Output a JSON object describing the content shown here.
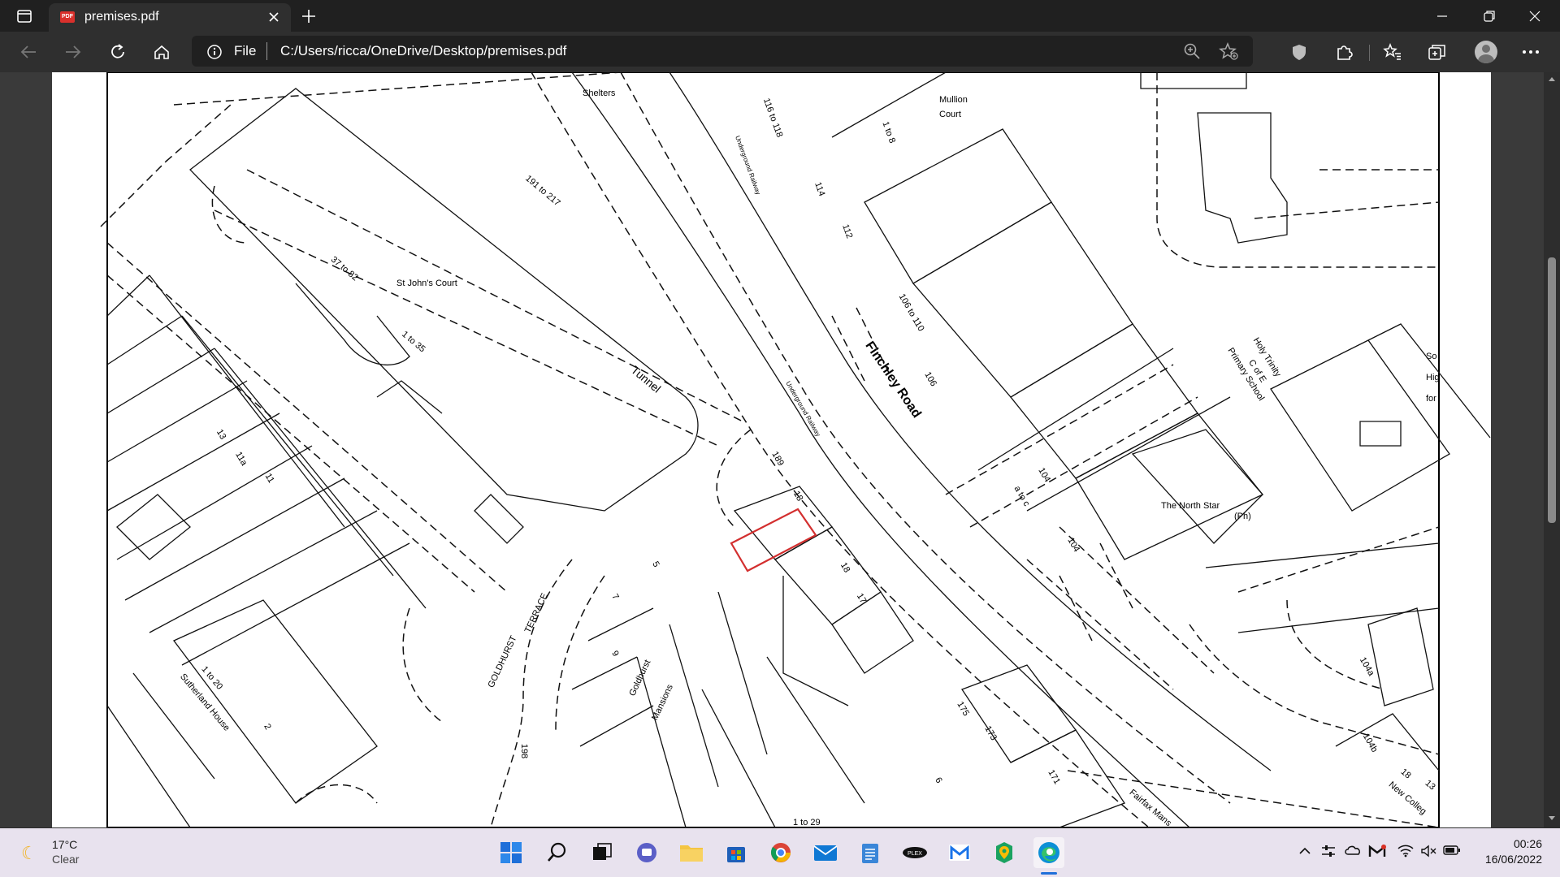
{
  "browser": {
    "tab_title": "premises.pdf",
    "tab_favicon_text": "PDF",
    "address_scheme": "File",
    "address_url": "C:/Users/ricca/OneDrive/Desktop/premises.pdf"
  },
  "map": {
    "labels": {
      "shelters": "Shelters",
      "mullion_court_1": "Mullion",
      "mullion_court_2": "Court",
      "range_116_118": "116 to 118",
      "range_1_8": "1 to 8",
      "range_191_217": "191 to 217",
      "underground_railway_1": "Underground Railway",
      "n114": "114",
      "n112": "112",
      "range_37_82": "37 to 82",
      "st_johns_court": "St John's Court",
      "range_106_110": "106 to 110",
      "range_1_35": "1 to 35",
      "finchley_road": "Finchley Road",
      "tunnel": "Tunnel",
      "holy_trinity_1": "Holy Trinity",
      "holy_trinity_2": "C of E",
      "holy_trinity_3": "Primary School",
      "n106": "106",
      "underground_railway_2": "Underground Railway",
      "n13": "13",
      "n11a": "11a",
      "n11": "11",
      "n189": "189",
      "n18": "18",
      "the_north_star": "The North Star",
      "ph": "(Ph)",
      "range_b_c": "a to c",
      "n104": "104",
      "n104_b": "104",
      "n18_b": "18",
      "n17": "17",
      "goldhurst_terrace_1": "TERRACE",
      "goldhurst_terrace_2": "GOLDHURST",
      "range_1_20": "1 to 20",
      "sutherland_house": "Sutherland House",
      "goldhurst_mansions_1": "Goldhurst",
      "goldhurst_mansions_2": "Mansions",
      "n104a": "104a",
      "n104b": "104b",
      "n175": "175",
      "n173": "173",
      "n171": "171",
      "n198": "198",
      "range_1_29": "1 to 29",
      "fairfax_mansions": "Fairfax Mans",
      "n18_c": "18",
      "n13_b": "13",
      "new_college": "New Colleg",
      "edge_so": "So",
      "edge_hig": "Hig",
      "edge_for": "for",
      "n6": "6",
      "n7": "7",
      "n5": "5",
      "n2": "2",
      "n9": "9"
    }
  },
  "taskbar": {
    "temperature": "17°C",
    "condition": "Clear",
    "time": "00:26",
    "date": "16/06/2022",
    "apps": [
      "start-icon",
      "search-icon",
      "task-view-icon",
      "teams-chat-icon",
      "file-explorer-icon",
      "store-icon",
      "chrome-icon",
      "mail-icon",
      "notepad-icon",
      "media-app-icon",
      "gmail-icon",
      "maps-pin-icon",
      "edge-icon"
    ]
  },
  "colors": {
    "titlebar": "#202020",
    "toolbar": "#2f2f2f",
    "viewer_bg": "#3a3a3a",
    "highlight_red": "#d32f2f",
    "taskbar": "#e8e2ee"
  }
}
